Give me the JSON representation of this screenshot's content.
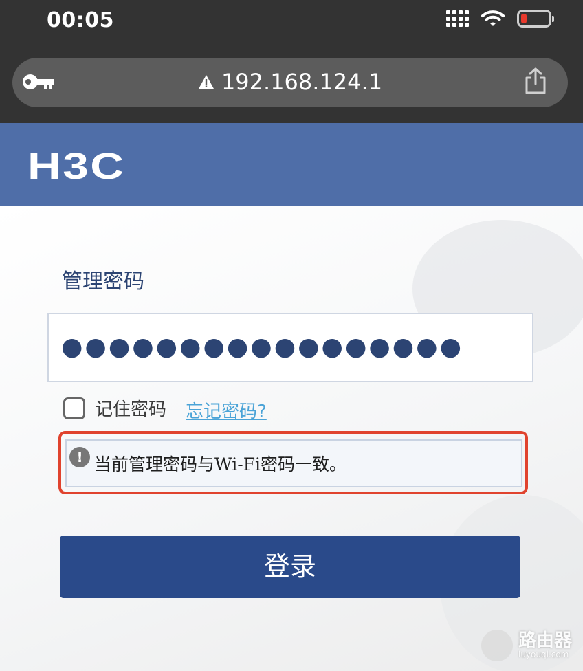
{
  "status_bar": {
    "time": "00:05",
    "battery_color": "#e8392c",
    "icons": [
      "signal-icon",
      "wifi-icon",
      "battery-icon"
    ]
  },
  "browser": {
    "url": "192.168.124.1",
    "icons": [
      "key-icon",
      "warning-icon",
      "share-icon"
    ]
  },
  "brand": {
    "logo_text": "H3C",
    "color": "#4f6ea8"
  },
  "login": {
    "field_label": "管理密码",
    "password_value": "●●●●●●●●●●●●●●●●●",
    "remember_label": "记住密码",
    "remember_checked": false,
    "forgot_link": "忘记密码?",
    "notice_text": "当前管理密码与Wi-Fi密码一致。",
    "notice_icon": "exclamation-icon",
    "login_button": "登录",
    "button_color": "#2a4a8a",
    "highlight_color": "#e0432e"
  },
  "watermark": {
    "title": "路由器",
    "subtitle": "luyouqi.com"
  }
}
